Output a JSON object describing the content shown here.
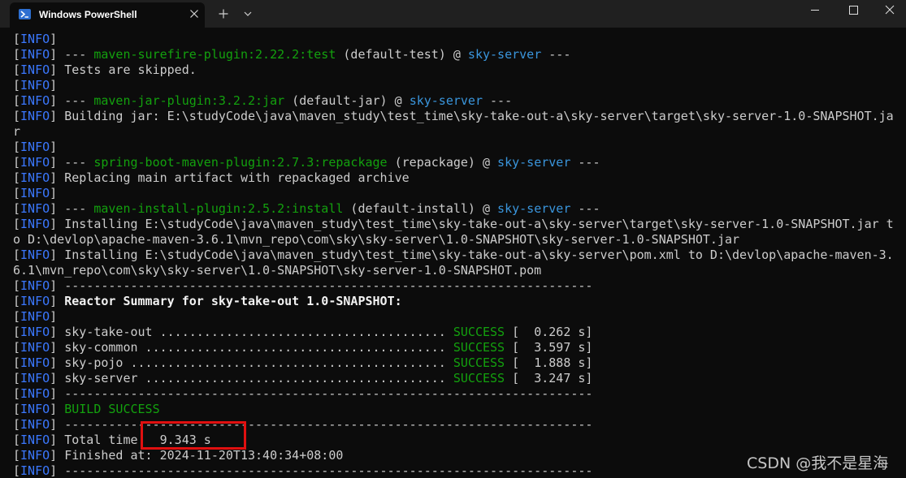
{
  "titlebar": {
    "tab_title": "Windows PowerShell",
    "tab_icon": "powershell-icon",
    "close_tab_icon": "close-icon",
    "new_tab_icon": "plus-icon",
    "dropdown_icon": "chevron-down-icon",
    "minimize_icon": "minimize-icon",
    "maximize_icon": "maximize-icon",
    "close_window_icon": "close-icon"
  },
  "colors": {
    "background": "#0c0c0c",
    "titlebar": "#202020",
    "info_tag": "#3b78ff",
    "plugin": "#13a10e",
    "project": "#3a96dd",
    "highlight_box": "#e01010"
  },
  "terminal": {
    "lines": [
      [
        {
          "t": "[",
          "c": ""
        },
        {
          "t": "INFO",
          "c": "b"
        },
        {
          "t": "]",
          "c": ""
        }
      ],
      [
        {
          "t": "[",
          "c": ""
        },
        {
          "t": "INFO",
          "c": "b"
        },
        {
          "t": "] --- ",
          "c": ""
        },
        {
          "t": "maven-surefire-plugin:2.22.2:test",
          "c": "g"
        },
        {
          "t": " (default-test) @ ",
          "c": ""
        },
        {
          "t": "sky-server",
          "c": "bl"
        },
        {
          "t": " ---",
          "c": ""
        }
      ],
      [
        {
          "t": "[",
          "c": ""
        },
        {
          "t": "INFO",
          "c": "b"
        },
        {
          "t": "] Tests are skipped.",
          "c": ""
        }
      ],
      [
        {
          "t": "[",
          "c": ""
        },
        {
          "t": "INFO",
          "c": "b"
        },
        {
          "t": "]",
          "c": ""
        }
      ],
      [
        {
          "t": "[",
          "c": ""
        },
        {
          "t": "INFO",
          "c": "b"
        },
        {
          "t": "] --- ",
          "c": ""
        },
        {
          "t": "maven-jar-plugin:3.2.2:jar",
          "c": "g"
        },
        {
          "t": " (default-jar) @ ",
          "c": ""
        },
        {
          "t": "sky-server",
          "c": "bl"
        },
        {
          "t": " ---",
          "c": ""
        }
      ],
      [
        {
          "t": "[",
          "c": ""
        },
        {
          "t": "INFO",
          "c": "b"
        },
        {
          "t": "] Building jar: E:\\studyCode\\java\\maven_study\\test_time\\sky-take-out-a\\sky-server\\target\\sky-server-1.0-SNAPSHOT.ja",
          "c": ""
        }
      ],
      [
        {
          "t": "r",
          "c": ""
        }
      ],
      [
        {
          "t": "[",
          "c": ""
        },
        {
          "t": "INFO",
          "c": "b"
        },
        {
          "t": "]",
          "c": ""
        }
      ],
      [
        {
          "t": "[",
          "c": ""
        },
        {
          "t": "INFO",
          "c": "b"
        },
        {
          "t": "] --- ",
          "c": ""
        },
        {
          "t": "spring-boot-maven-plugin:2.7.3:repackage",
          "c": "g"
        },
        {
          "t": " (repackage) @ ",
          "c": ""
        },
        {
          "t": "sky-server",
          "c": "bl"
        },
        {
          "t": " ---",
          "c": ""
        }
      ],
      [
        {
          "t": "[",
          "c": ""
        },
        {
          "t": "INFO",
          "c": "b"
        },
        {
          "t": "] Replacing main artifact with repackaged archive",
          "c": ""
        }
      ],
      [
        {
          "t": "[",
          "c": ""
        },
        {
          "t": "INFO",
          "c": "b"
        },
        {
          "t": "]",
          "c": ""
        }
      ],
      [
        {
          "t": "[",
          "c": ""
        },
        {
          "t": "INFO",
          "c": "b"
        },
        {
          "t": "] --- ",
          "c": ""
        },
        {
          "t": "maven-install-plugin:2.5.2:install",
          "c": "g"
        },
        {
          "t": " (default-install) @ ",
          "c": ""
        },
        {
          "t": "sky-server",
          "c": "bl"
        },
        {
          "t": " ---",
          "c": ""
        }
      ],
      [
        {
          "t": "[",
          "c": ""
        },
        {
          "t": "INFO",
          "c": "b"
        },
        {
          "t": "] Installing E:\\studyCode\\java\\maven_study\\test_time\\sky-take-out-a\\sky-server\\target\\sky-server-1.0-SNAPSHOT.jar t",
          "c": ""
        }
      ],
      [
        {
          "t": "o D:\\devlop\\apache-maven-3.6.1\\mvn_repo\\com\\sky\\sky-server\\1.0-SNAPSHOT\\sky-server-1.0-SNAPSHOT.jar",
          "c": ""
        }
      ],
      [
        {
          "t": "[",
          "c": ""
        },
        {
          "t": "INFO",
          "c": "b"
        },
        {
          "t": "] Installing E:\\studyCode\\java\\maven_study\\test_time\\sky-take-out-a\\sky-server\\pom.xml to D:\\devlop\\apache-maven-3.",
          "c": ""
        }
      ],
      [
        {
          "t": "6.1\\mvn_repo\\com\\sky\\sky-server\\1.0-SNAPSHOT\\sky-server-1.0-SNAPSHOT.pom",
          "c": ""
        }
      ],
      [
        {
          "t": "[",
          "c": ""
        },
        {
          "t": "INFO",
          "c": "b"
        },
        {
          "t": "] ------------------------------------------------------------------------",
          "c": ""
        }
      ],
      [
        {
          "t": "[",
          "c": ""
        },
        {
          "t": "INFO",
          "c": "b"
        },
        {
          "t": "] ",
          "c": ""
        },
        {
          "t": "Reactor Summary for sky-take-out 1.0-SNAPSHOT:",
          "c": "w"
        }
      ],
      [
        {
          "t": "[",
          "c": ""
        },
        {
          "t": "INFO",
          "c": "b"
        },
        {
          "t": "]",
          "c": ""
        }
      ],
      [
        {
          "t": "[",
          "c": ""
        },
        {
          "t": "INFO",
          "c": "b"
        },
        {
          "t": "] sky-take-out ....................................... ",
          "c": ""
        },
        {
          "t": "SUCCESS",
          "c": "g"
        },
        {
          "t": " [  0.262 s]",
          "c": ""
        }
      ],
      [
        {
          "t": "[",
          "c": ""
        },
        {
          "t": "INFO",
          "c": "b"
        },
        {
          "t": "] sky-common ......................................... ",
          "c": ""
        },
        {
          "t": "SUCCESS",
          "c": "g"
        },
        {
          "t": " [  3.597 s]",
          "c": ""
        }
      ],
      [
        {
          "t": "[",
          "c": ""
        },
        {
          "t": "INFO",
          "c": "b"
        },
        {
          "t": "] sky-pojo ........................................... ",
          "c": ""
        },
        {
          "t": "SUCCESS",
          "c": "g"
        },
        {
          "t": " [  1.888 s]",
          "c": ""
        }
      ],
      [
        {
          "t": "[",
          "c": ""
        },
        {
          "t": "INFO",
          "c": "b"
        },
        {
          "t": "] sky-server ......................................... ",
          "c": ""
        },
        {
          "t": "SUCCESS",
          "c": "g"
        },
        {
          "t": " [  3.247 s]",
          "c": ""
        }
      ],
      [
        {
          "t": "[",
          "c": ""
        },
        {
          "t": "INFO",
          "c": "b"
        },
        {
          "t": "] ------------------------------------------------------------------------",
          "c": ""
        }
      ],
      [
        {
          "t": "[",
          "c": ""
        },
        {
          "t": "INFO",
          "c": "b"
        },
        {
          "t": "] ",
          "c": ""
        },
        {
          "t": "BUILD SUCCESS",
          "c": "g"
        }
      ],
      [
        {
          "t": "[",
          "c": ""
        },
        {
          "t": "INFO",
          "c": "b"
        },
        {
          "t": "] ------------------------------------------------------------------------",
          "c": ""
        }
      ],
      [
        {
          "t": "[",
          "c": ""
        },
        {
          "t": "INFO",
          "c": "b"
        },
        {
          "t": "] Total time:  9.343 s",
          "c": ""
        }
      ],
      [
        {
          "t": "[",
          "c": ""
        },
        {
          "t": "INFO",
          "c": "b"
        },
        {
          "t": "] Finished at: 2024-11-20T13:40:34+08:00",
          "c": ""
        }
      ],
      [
        {
          "t": "[",
          "c": ""
        },
        {
          "t": "INFO",
          "c": "b"
        },
        {
          "t": "] ------------------------------------------------------------------------",
          "c": ""
        }
      ]
    ]
  },
  "watermark": "CSDN @我不是星海"
}
